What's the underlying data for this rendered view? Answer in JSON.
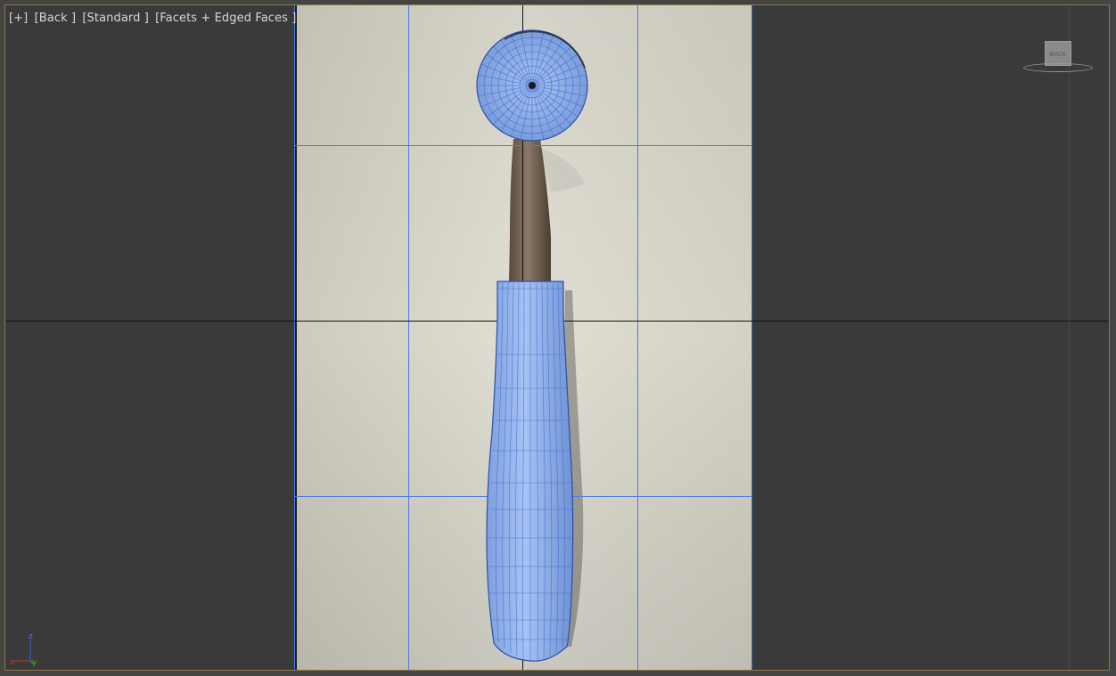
{
  "viewport": {
    "label_parts": [
      "[+]",
      "[Back ]",
      "[Standard ]",
      "[Facets + Edged Faces ]"
    ],
    "viewcube_face": "BACK",
    "axis": {
      "z": "z",
      "x": "x",
      "y": "y"
    }
  },
  "colors": {
    "viewport_bg": "#3a3a3a",
    "border": "#8e7a48",
    "grid_blue": "#4a7ce6",
    "mesh_fill": "#8fb2ee",
    "mesh_line": "#3a65c8",
    "backdrop": "#dcd9cc"
  },
  "icons": [
    "viewcube-icon",
    "axis-tripod-icon"
  ]
}
